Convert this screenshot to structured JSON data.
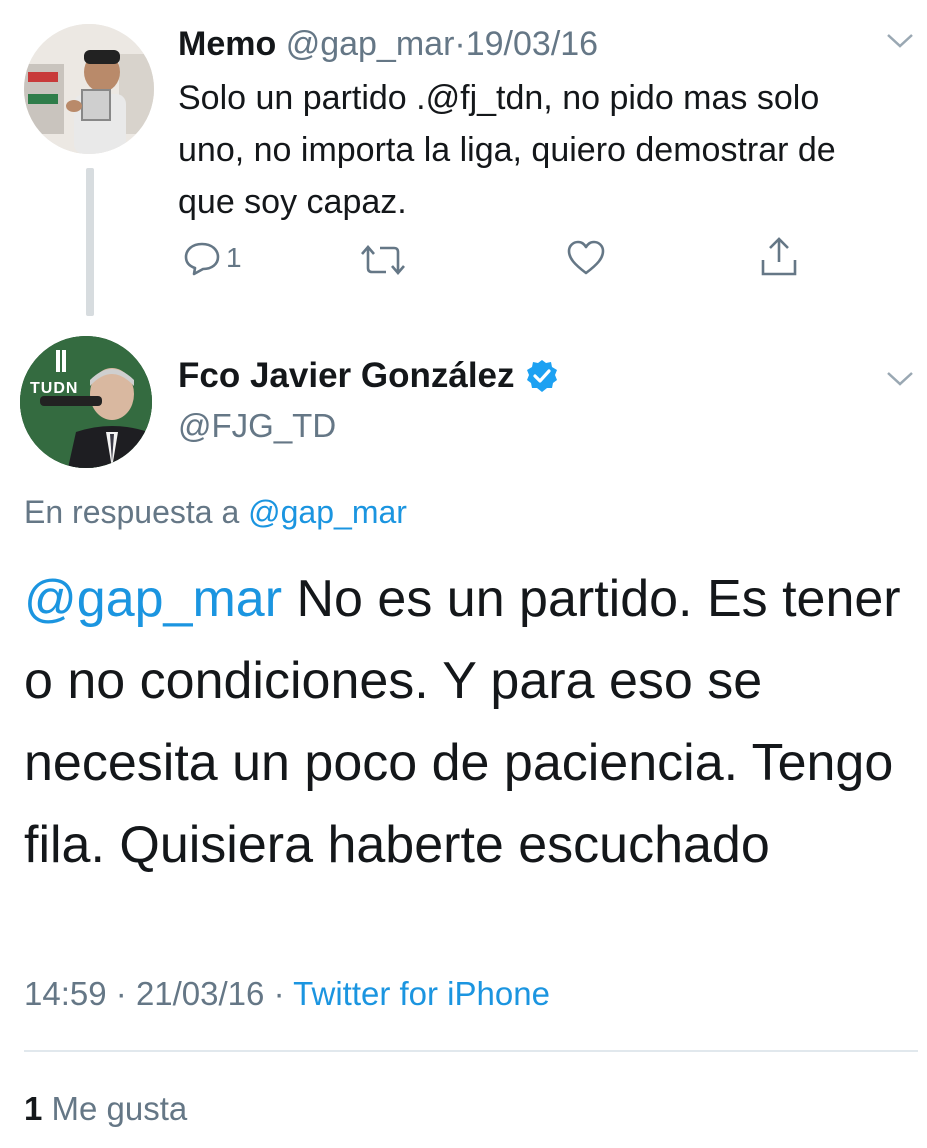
{
  "reply_tweet": {
    "display_name": "Memo",
    "handle": "@gap_mar",
    "separator": "·",
    "date": "19/03/16",
    "text": "Solo un partido .@fj_tdn, no pido mas solo uno, no importa la liga, quiero demostrar de que soy capaz.",
    "reply_count": "1",
    "icons": [
      "reply-icon",
      "retweet-icon",
      "like-icon",
      "share-icon",
      "chevron-down-icon"
    ]
  },
  "main_tweet": {
    "display_name": "Fco Javier González",
    "handle": "@FJG_TD",
    "verified": true,
    "in_reply_prefix": "En respuesta a",
    "in_reply_handle": "@gap_mar",
    "mention": "@gap_mar",
    "text": "No es un partido. Es tener o no condiciones. Y para eso se necesita un poco de paciencia. Tengo fila. Quisiera haberte escuchado",
    "time": "14:59",
    "meta_separator": "·",
    "date": "21/03/16",
    "source": "Twitter for iPhone",
    "like_count": "1",
    "like_label": "Me gusta",
    "avatar_logo_text": "TUDN"
  },
  "colors": {
    "text": "#14171a",
    "muted": "#657786",
    "link": "#1b95e0",
    "verified": "#1da1f2",
    "divider": "#e1e8ed"
  }
}
